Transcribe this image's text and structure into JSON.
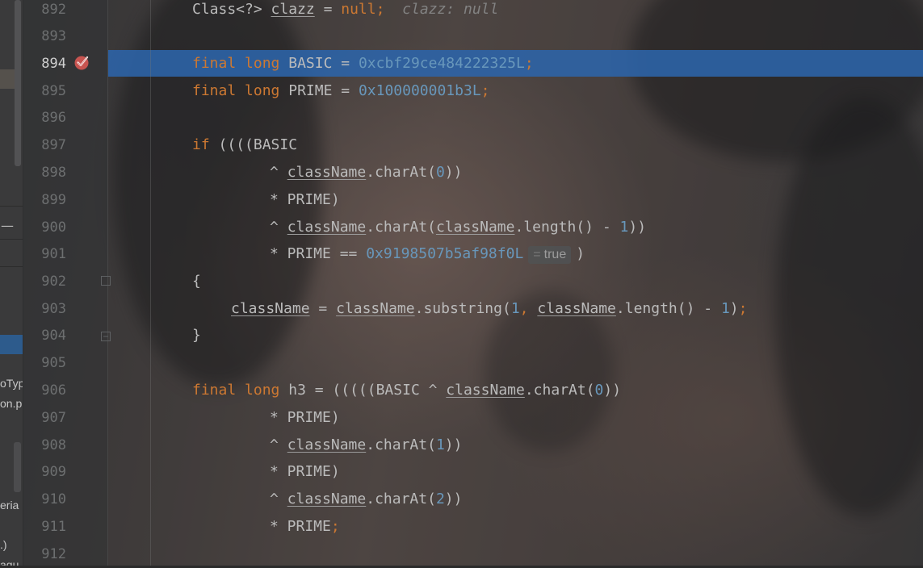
{
  "gutter": {
    "line_numbers": [
      "892",
      "893",
      "894",
      "895",
      "896",
      "897",
      "898",
      "899",
      "900",
      "901",
      "902",
      "903",
      "904",
      "905",
      "906",
      "907",
      "908",
      "909",
      "910",
      "911",
      "912"
    ],
    "current_line": "894",
    "breakpoint": {
      "line": "894",
      "color": "#c75450"
    }
  },
  "left_panel": {
    "fragments": [
      "oTyp",
      "on.p",
      "eria",
      ".)",
      "agu"
    ]
  },
  "colors": {
    "keyword": "#cc7832",
    "number": "#6897bb",
    "text": "#bbbbbb",
    "execution_line": "#2c64aa"
  },
  "code": {
    "l892": {
      "text": "Class<?> ",
      "var": "clazz",
      "eq": " = ",
      "kw": "null",
      "semi": ";",
      "hint": "clazz: null"
    },
    "l894": {
      "kw1": "final",
      "kw2": "long",
      "name": " BASIC = ",
      "num": "0xcbf29ce484222325L",
      "semi": ";"
    },
    "l895": {
      "kw1": "final",
      "kw2": "long",
      "name": " PRIME = ",
      "num": "0x100000001b3L",
      "semi": ";"
    },
    "l897": {
      "kw": "if",
      "rest": " ((((BASIC"
    },
    "l898": {
      "op": "^ ",
      "var": "className",
      "call": ".charAt(",
      "num": "0",
      "end": "))"
    },
    "l899": {
      "text": "* PRIME)"
    },
    "l900": {
      "op": "^ ",
      "var": "className",
      "call": ".charAt(",
      "var2": "className",
      "call2": ".length() - ",
      "num": "1",
      "end": "))"
    },
    "l901": {
      "text": "* PRIME == ",
      "num": "0x9198507b5af98f0L",
      "inlay_eq": "=",
      "inlay_val": "true",
      "end": ")"
    },
    "l902": {
      "text": "{"
    },
    "l903": {
      "var": "className",
      "eq": " = ",
      "var2": "className",
      "call": ".substring(",
      "num1": "1",
      "comma": ", ",
      "var3": "className",
      "call2": ".length() - ",
      "num2": "1",
      "end": ")",
      "semi": ";"
    },
    "l904": {
      "text": "}"
    },
    "l906": {
      "kw1": "final",
      "kw2": "long",
      "rest": " h3 = (((((BASIC ^ ",
      "var": "className",
      "call": ".charAt(",
      "num": "0",
      "end": "))"
    },
    "l907": {
      "text": "* PRIME)"
    },
    "l908": {
      "op": "^ ",
      "var": "className",
      "call": ".charAt(",
      "num": "1",
      "end": "))"
    },
    "l909": {
      "text": "* PRIME)"
    },
    "l910": {
      "op": "^ ",
      "var": "className",
      "call": ".charAt(",
      "num": "2",
      "end": "))"
    },
    "l911": {
      "text": "* PRIME",
      "semi": ";"
    }
  }
}
